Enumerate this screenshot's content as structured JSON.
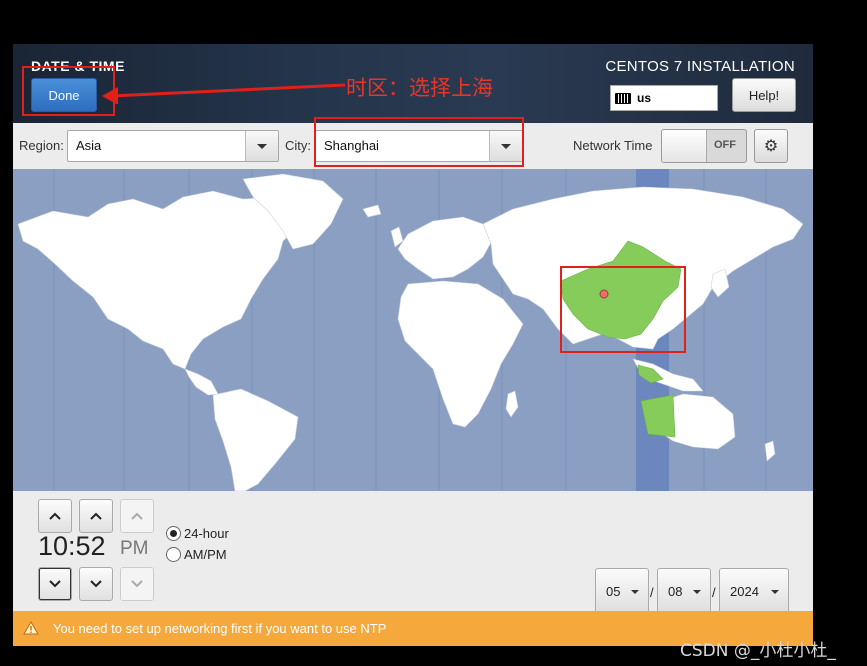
{
  "header": {
    "title": "DATE & TIME",
    "installer": "CENTOS 7 INSTALLATION",
    "done_label": "Done",
    "keyboard_layout": "us",
    "help_label": "Help!"
  },
  "toolbar": {
    "region_label": "Region:",
    "region_value": "Asia",
    "city_label": "City:",
    "city_value": "Shanghai",
    "network_time_label": "Network Time",
    "network_time_state": "OFF"
  },
  "clock": {
    "time": "10:52",
    "ampm": "PM",
    "format_options": [
      "24-hour",
      "AM/PM"
    ],
    "selected_format": "24-hour"
  },
  "date": {
    "month": "05",
    "day": "08",
    "year": "2024",
    "separator": "/"
  },
  "warning": {
    "text": "You need to set up networking first if you want to use NTP"
  },
  "annotation": {
    "note": "时区：选择上海",
    "color": "#e0201a"
  },
  "watermark": "CSDN @_小杜小杜_",
  "colors": {
    "accent": "#3a7fcf",
    "map_water": "#8b9fc2",
    "map_land": "#ffffff",
    "selected_zone": "#85cc5a",
    "warning": "#f5a83c"
  }
}
